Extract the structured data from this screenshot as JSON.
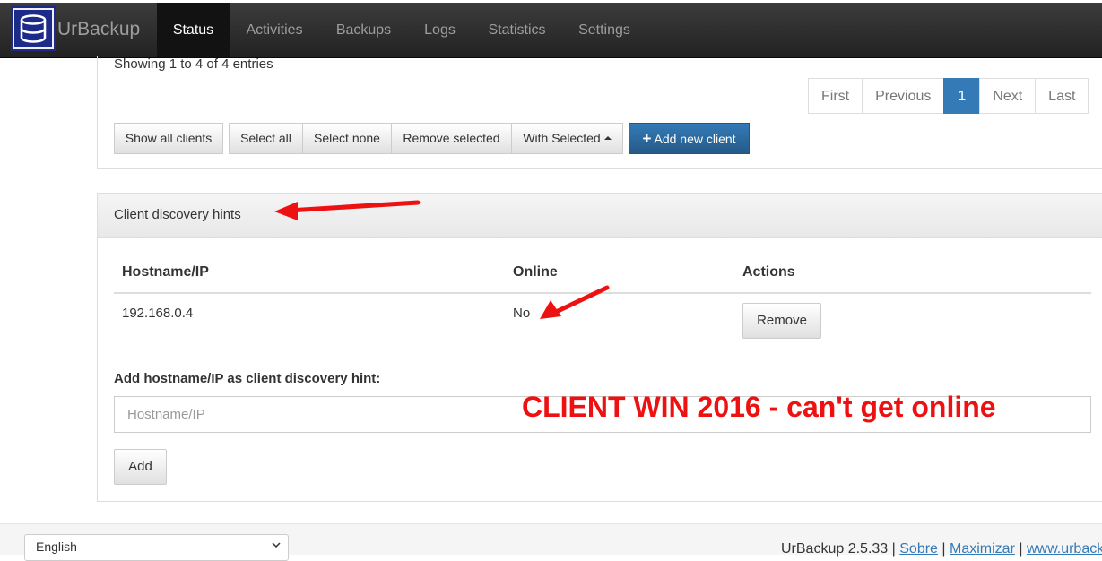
{
  "navbar": {
    "brand": "UrBackup",
    "items": [
      {
        "label": "Status",
        "active": true
      },
      {
        "label": "Activities"
      },
      {
        "label": "Backups"
      },
      {
        "label": "Logs"
      },
      {
        "label": "Statistics"
      },
      {
        "label": "Settings"
      }
    ]
  },
  "clients": {
    "showing_text": "Showing 1 to 4 of 4 entries",
    "pagination": [
      "First",
      "Previous",
      "1",
      "Next",
      "Last"
    ],
    "buttons": {
      "show_all": "Show all clients",
      "select_all": "Select all",
      "select_none": "Select none",
      "remove_selected": "Remove selected",
      "with_selected": "With Selected",
      "add_new_client": "Add new client"
    }
  },
  "discovery": {
    "title": "Client discovery hints",
    "columns": [
      "Hostname/IP",
      "Online",
      "Actions"
    ],
    "rows": [
      {
        "hostname": "192.168.0.4",
        "online": "No",
        "action": "Remove"
      }
    ],
    "add_label": "Add hostname/IP as client discovery hint:",
    "input_placeholder": "Hostname/IP",
    "add_button": "Add"
  },
  "annotation": {
    "text": "CLIENT WIN 2016 - can't get online",
    "color": "#ee1111"
  },
  "footer": {
    "language": "English",
    "version": "UrBackup 2.5.33",
    "sep": "|",
    "links": [
      "Sobre",
      "Maximizar",
      "www.urbackup.org"
    ]
  },
  "colors": {
    "primary": "#337ab7",
    "navbar": "#222222",
    "annotation_red": "#ee1111"
  }
}
